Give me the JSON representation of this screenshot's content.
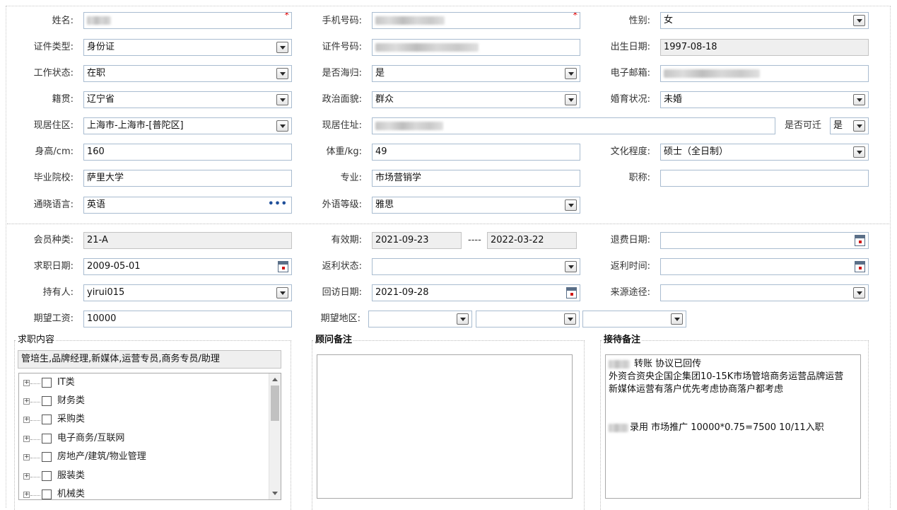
{
  "basic": {
    "name_label": "姓名:",
    "phone_label": "手机号码:",
    "gender_label": "性别:",
    "gender_value": "女",
    "idtype_label": "证件类型:",
    "idtype_value": "身份证",
    "idno_label": "证件号码:",
    "birth_label": "出生日期:",
    "birth_value": "1997-08-18",
    "workstatus_label": "工作状态:",
    "workstatus_value": "在职",
    "overseas_label": "是否海归:",
    "overseas_value": "是",
    "email_label": "电子邮箱:",
    "native_label": "籍贯:",
    "native_value": "辽宁省",
    "political_label": "政治面貌:",
    "political_value": "群众",
    "marital_label": "婚育状况:",
    "marital_value": "未婚",
    "region_label": "现居住区:",
    "region_value": "上海市-上海市-[普陀区]",
    "address_label": "现居住址:",
    "relocate_label": "是否可迁",
    "relocate_value": "是",
    "height_label": "身高/cm:",
    "height_value": "160",
    "weight_label": "体重/kg:",
    "weight_value": "49",
    "education_label": "文化程度:",
    "education_value": "硕士（全日制）",
    "school_label": "毕业院校:",
    "school_value": "萨里大学",
    "major_label": "专业:",
    "major_value": "市场营销学",
    "title_label": "职称:",
    "title_value": "",
    "language_label": "通晓语言:",
    "language_value": "英语",
    "language_level_label": "外语等级:",
    "language_level_value": "雅思",
    "required_mark": "*",
    "more_dots": "•••"
  },
  "membership": {
    "type_label": "会员种类:",
    "type_value": "21-A",
    "valid_label": "有效期:",
    "valid_from": "2021-09-23",
    "valid_sep": "----",
    "valid_to": "2022-03-22",
    "refund_label": "退费日期:",
    "refund_value": "",
    "jobsearch_label": "求职日期:",
    "jobsearch_value": "2009-05-01",
    "rebate_status_label": "返利状态:",
    "rebate_status_value": "",
    "rebate_time_label": "返利时间:",
    "rebate_time_value": "",
    "holder_label": "持有人:",
    "holder_value": "yirui015",
    "visit_label": "回访日期:",
    "visit_value": "2021-09-28",
    "source_label": "来源途径:",
    "source_value": "",
    "salary_label": "期望工资:",
    "salary_value": "10000",
    "area_label": "期望地区:"
  },
  "job_content": {
    "legend": "求职内容",
    "selected": "管培生,品牌经理,新媒体,运营专员,商务专员/助理",
    "categories": [
      "IT类",
      "财务类",
      "采购类",
      "电子商务/互联网",
      "房地产/建筑/物业管理",
      "服装类",
      "机械类"
    ]
  },
  "consultant_notes": {
    "legend": "顾问备注",
    "text": ""
  },
  "reception_notes": {
    "legend": "接待备注",
    "line1": "转账 协议已回传",
    "line2": "外资合资央企国企集团10-15K市场管培商务运营品牌运营",
    "line3": "新媒体运营有落户优先考虑协商落户都考虑",
    "line4": "录用 市场推广  10000*0.75=7500  10/11入职"
  }
}
